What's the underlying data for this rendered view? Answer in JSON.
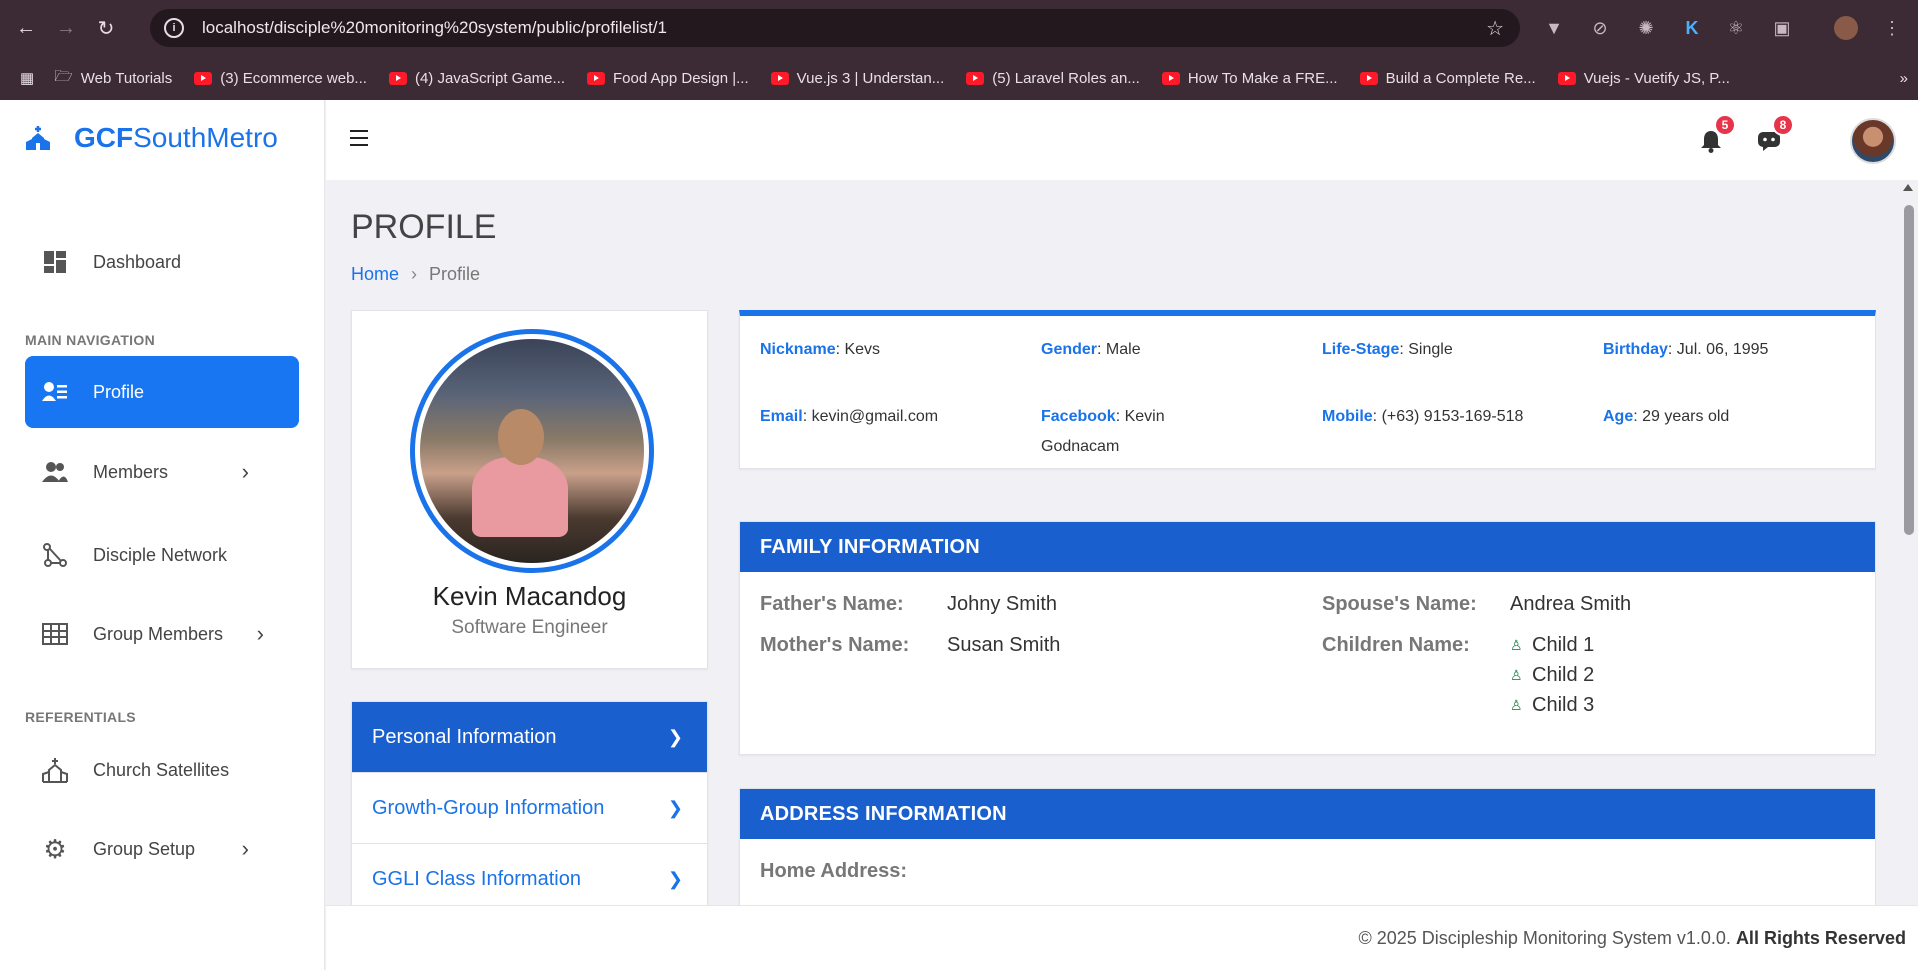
{
  "browser": {
    "url": "localhost/disciple%20monitoring%20system/public/profilelist/1",
    "bookmarks": [
      {
        "label": "Web Tutorials",
        "type": "folder"
      },
      {
        "label": "(3) Ecommerce web...",
        "type": "youtube"
      },
      {
        "label": "(4) JavaScript Game...",
        "type": "youtube"
      },
      {
        "label": "Food App Design |...",
        "type": "youtube"
      },
      {
        "label": "Vue.js 3 | Understan...",
        "type": "youtube"
      },
      {
        "label": "(5) Laravel Roles an...",
        "type": "youtube"
      },
      {
        "label": "How To Make a FRE...",
        "type": "youtube"
      },
      {
        "label": "Build a Complete Re...",
        "type": "youtube"
      },
      {
        "label": "Vuejs - Vuetify JS, P...",
        "type": "youtube"
      }
    ]
  },
  "brand": {
    "part1": "GCF",
    "part2": "SouthMetro"
  },
  "sidebar": {
    "dashboard": "Dashboard",
    "section_main": "MAIN NAVIGATION",
    "profile": "Profile",
    "members": "Members",
    "disciple_network": "Disciple Network",
    "group_members": "Group Members",
    "section_ref": "REFERENTIALS",
    "church_satellites": "Church Satellites",
    "group_setup": "Group Setup"
  },
  "topbar": {
    "notifications_count": "5",
    "messages_count": "8"
  },
  "page": {
    "title": "PROFILE",
    "breadcrumb_home": "Home",
    "breadcrumb_current": "Profile"
  },
  "profile": {
    "name": "Kevin Macandog",
    "job_title": "Software Engineer",
    "menu": [
      "Personal Information",
      "Growth-Group Information",
      "GGLI Class Information"
    ]
  },
  "personal": {
    "nickname_label": "Nickname",
    "nickname": ": Kevs",
    "gender_label": "Gender",
    "gender": ": Male",
    "lifestage_label": "Life-Stage",
    "lifestage": ": Single",
    "birthday_label": "Birthday",
    "birthday": ": Jul. 06, 1995",
    "email_label": "Email",
    "email": ": kevin@gmail.com",
    "facebook_label": "Facebook",
    "facebook": ": Kevin Godnacam",
    "mobile_label": "Mobile",
    "mobile": ": (+63) 9153-169-518",
    "age_label": "Age",
    "age": ": 29 years old"
  },
  "family": {
    "header": "FAMILY INFORMATION",
    "father_label": "Father's Name:",
    "father": "Johny Smith",
    "mother_label": "Mother's Name:",
    "mother": "Susan Smith",
    "spouse_label": "Spouse's Name:",
    "spouse": "Andrea Smith",
    "children_label": "Children Name:",
    "children": [
      "Child 1",
      "Child 2",
      "Child 3"
    ]
  },
  "address": {
    "header": "ADDRESS INFORMATION",
    "home_label": "Home Address:"
  },
  "footer": {
    "text": "© 2025 Discipleship Monitoring System v1.0.0.",
    "rights": "All Rights Reserved"
  }
}
